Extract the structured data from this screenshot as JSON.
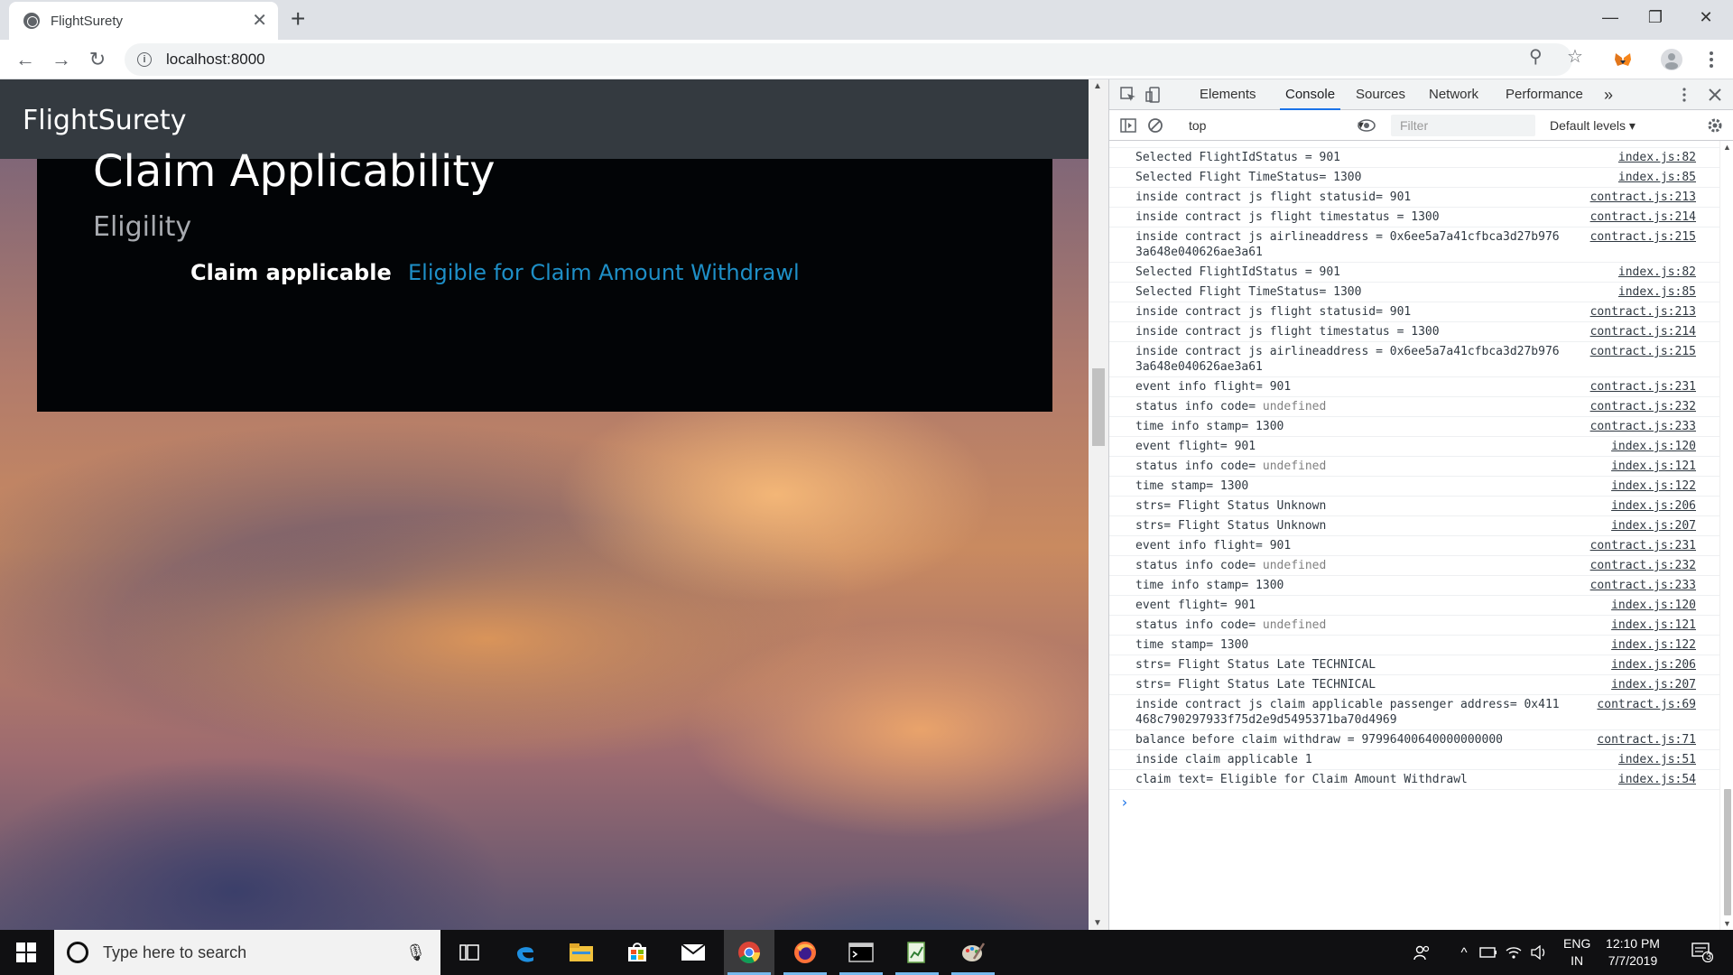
{
  "browser": {
    "tab_title": "FlightSurety",
    "url": "localhost:8000"
  },
  "page": {
    "brand": "FlightSurety",
    "section_title": "Claim Applicability",
    "subtitle": "Eligility",
    "claim_label": "Claim applicable",
    "claim_value": "Eligible for Claim Amount Withdrawl"
  },
  "devtools": {
    "tabs": [
      "Elements",
      "Console",
      "Sources",
      "Network",
      "Performance"
    ],
    "active_tab": "Console",
    "more_tabs": "»",
    "context": "top",
    "filter_placeholder": "Filter",
    "levels": "Default levels ▾",
    "messages": [
      {
        "text": "Selected FlightIdStatus = 901",
        "src": "index.js:82"
      },
      {
        "text": "Selected Flight TimeStatus= 1300",
        "src": "index.js:85"
      },
      {
        "text": "inside contract js flight statusid= 901",
        "src": "contract.js:213"
      },
      {
        "text": "inside contract js flight timestatus = 1300",
        "src": "contract.js:214"
      },
      {
        "text": "inside contract js airlineaddress = 0x6ee5a7a41cfbca3d27b9763a648e040626ae3a61",
        "src": "contract.js:215"
      },
      {
        "text": "Selected FlightIdStatus = 901",
        "src": "index.js:82"
      },
      {
        "text": "Selected Flight TimeStatus= 1300",
        "src": "index.js:85"
      },
      {
        "text": "inside contract js flight statusid= 901",
        "src": "contract.js:213"
      },
      {
        "text": "inside contract js flight timestatus = 1300",
        "src": "contract.js:214"
      },
      {
        "text": "inside contract js airlineaddress = 0x6ee5a7a41cfbca3d27b9763a648e040626ae3a61",
        "src": "contract.js:215"
      },
      {
        "text": "event info flight= 901",
        "src": "contract.js:231"
      },
      {
        "text": "status info code= ",
        "undef": "undefined",
        "src": "contract.js:232"
      },
      {
        "text": "time info stamp= 1300",
        "src": "contract.js:233"
      },
      {
        "text": "event flight= 901",
        "src": "index.js:120"
      },
      {
        "text": "status info code= ",
        "undef": "undefined",
        "src": "index.js:121"
      },
      {
        "text": "time stamp= 1300",
        "src": "index.js:122"
      },
      {
        "text": "strs= Flight Status Unknown",
        "src": "index.js:206"
      },
      {
        "text": "strs= Flight Status Unknown",
        "src": "index.js:207"
      },
      {
        "text": "event info flight= 901",
        "src": "contract.js:231"
      },
      {
        "text": "status info code= ",
        "undef": "undefined",
        "src": "contract.js:232"
      },
      {
        "text": "time info stamp= 1300",
        "src": "contract.js:233"
      },
      {
        "text": "event flight= 901",
        "src": "index.js:120"
      },
      {
        "text": "status info code= ",
        "undef": "undefined",
        "src": "index.js:121"
      },
      {
        "text": "time stamp= 1300",
        "src": "index.js:122"
      },
      {
        "text": "strs= Flight Status Late TECHNICAL",
        "src": "index.js:206"
      },
      {
        "text": "strs= Flight Status Late TECHNICAL",
        "src": "index.js:207"
      },
      {
        "text": "inside contract js claim applicable passenger address= 0x411468c790297933f75d2e9d5495371ba70d4969",
        "src": "contract.js:69"
      },
      {
        "text": "balance before claim withdraw = 97996400640000000000",
        "src": "contract.js:71"
      },
      {
        "text": "inside claim applicable 1",
        "src": "index.js:51"
      },
      {
        "text": "claim text= Eligible for Claim Amount Withdrawl",
        "src": "index.js:54"
      }
    ]
  },
  "taskbar": {
    "search_placeholder": "Type here to search",
    "lang_top": "ENG",
    "lang_bottom": "IN",
    "time": "12:10 PM",
    "date": "7/7/2019",
    "notification_count": "3"
  },
  "colors": {
    "navbar": "#343a40",
    "panel": "#020406",
    "claim_value": "#1e8fc7",
    "devtools_accent": "#1a73e8"
  }
}
